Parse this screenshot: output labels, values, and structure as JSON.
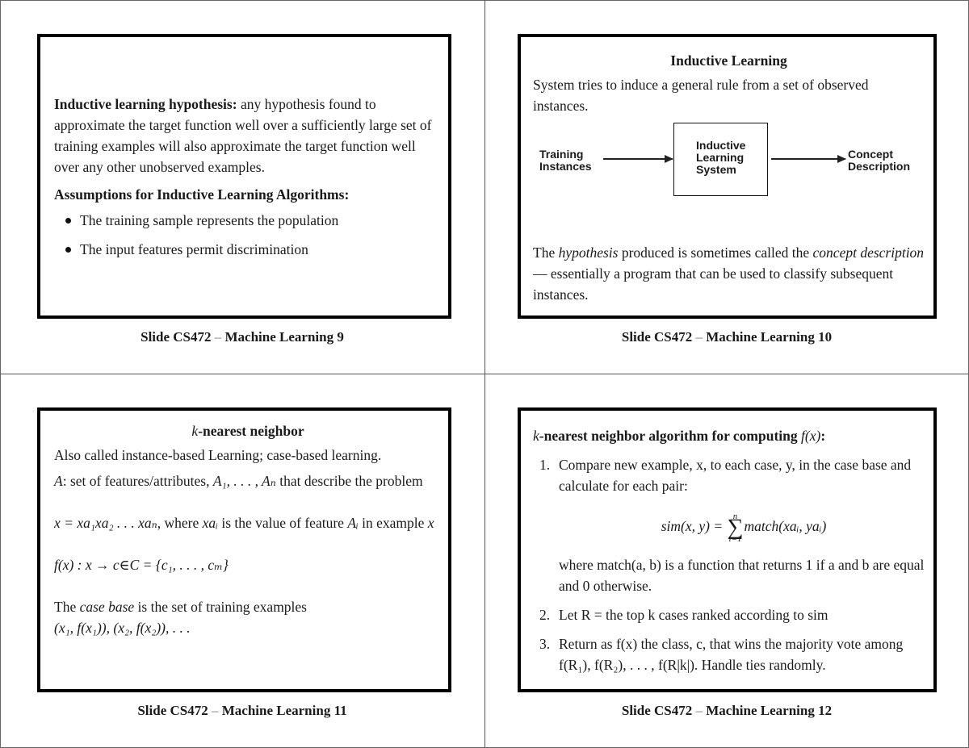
{
  "slides": [
    {
      "number": 9,
      "caption": {
        "prefix": "Slide CS472",
        "dash": "–",
        "suffix": "Machine Learning 9"
      },
      "hypothesis_label": "Inductive learning hypothesis:",
      "hypothesis_text": "any hypothesis found to approximate the target function well over a sufficiently large set of training examples will also approximate the target function well over any other unobserved examples.",
      "assumptions_heading": "Assumptions for Inductive Learning Algorithms:",
      "bullets": [
        "The training sample represents the population",
        "The input features permit discrimination"
      ]
    },
    {
      "number": 10,
      "caption": {
        "prefix": "Slide CS472",
        "dash": "–",
        "suffix": "Machine Learning 10"
      },
      "title": "Inductive Learning",
      "intro": "System tries to induce a general rule from a set of observed instances.",
      "diagram": {
        "input_line1": "Training",
        "input_line2": "Instances",
        "system_line1": "Inductive",
        "system_line2": "Learning",
        "system_line3": "System",
        "output_line1": "Concept",
        "output_line2": "Description"
      },
      "bottom": {
        "t1": "The ",
        "t2": "hypothesis",
        "t3": " produced is sometimes called the ",
        "t4": "concept description",
        "t5": " — essentially a program that can be used to classify subsequent instances."
      }
    },
    {
      "number": 11,
      "caption": {
        "prefix": "Slide CS472",
        "dash": "–",
        "suffix": "Machine Learning 11"
      },
      "title_k": "k",
      "title_rest": "-nearest neighbor",
      "line1": "Also called instance-based Learning; case-based learning.",
      "line2_var": "A",
      "line2_mid": ": set of features/attributes, ",
      "line2_math": "A₁, . . . , Aₙ",
      "line2_end": " that describe the problem",
      "line3_math": "x = xa₁xa₂ . . . xaₙ",
      "line3_mid": ", where ",
      "line3_math2": "xaᵢ",
      "line3_mid2": " is the value of feature ",
      "line3_math3": "Aᵢ",
      "line3_end": " in example ",
      "line3_var": "x",
      "line4_math": "f(x) : x → c∈C = {c₁, . . . , cₘ}",
      "line5_a": "The ",
      "line5_b": "case base",
      "line5_c": " is the set of training examples",
      "line6_math": "(x₁, f(x₁)), (x₂, f(x₂)), . . ."
    },
    {
      "number": 12,
      "caption": {
        "prefix": "Slide CS472",
        "dash": "–",
        "suffix": "Machine Learning 12"
      },
      "heading_k": "k",
      "heading_rest": "-nearest neighbor algorithm for computing ",
      "heading_math": "f(x)",
      "heading_colon": ":",
      "steps": [
        {
          "num": "1.",
          "text": "Compare new example, x, to each case, y, in the case base and calculate for each pair:",
          "formula_lhs": "sim(x, y) = ",
          "formula_sum_top": "n",
          "formula_sum_bottom": "i=1",
          "formula_rhs": "match(xaᵢ, yaᵢ)",
          "after": "where match(a, b) is a function that returns 1 if a and b are equal and 0 otherwise."
        },
        {
          "num": "2.",
          "text": "Let R = the top k cases ranked according to sim"
        },
        {
          "num": "3.",
          "text": "Return as f(x) the class, c, that wins the majority vote among f(R₁), f(R₂), . . . , f(R|k|). Handle ties randomly."
        }
      ]
    }
  ]
}
